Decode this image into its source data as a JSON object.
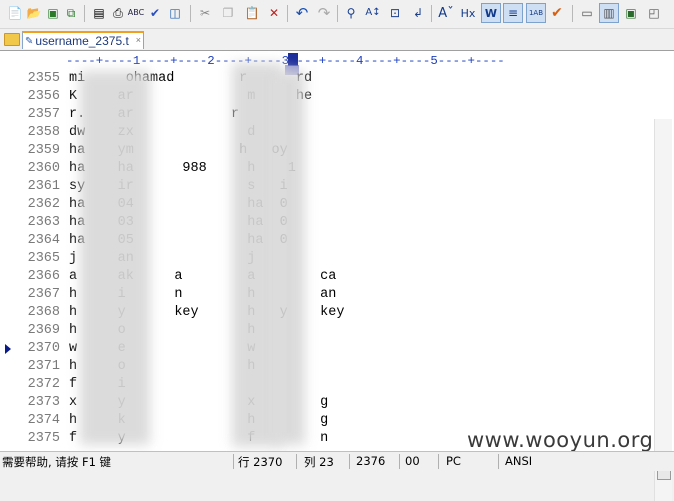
{
  "toolbar": {
    "icons": [
      "new-file-icon",
      "open-folder-icon",
      "save-icon",
      "save-all-icon",
      "print-preview-icon",
      "print-icon",
      "spellcheck-icon",
      "check-icon",
      "web-preview-icon",
      "cut-icon",
      "copy-icon",
      "paste-icon",
      "delete-icon",
      "undo-icon",
      "redo-icon",
      "find-icon",
      "replace-icon",
      "goto-icon",
      "insert-icon",
      "font-size-icon",
      "hex-icon",
      "word-wrap-icon",
      "ruler-icon",
      "line-numbers-icon",
      "spell-check-icon",
      "view-icon",
      "fullscreen-icon",
      "window-icon",
      "clip-icon"
    ]
  },
  "tab": {
    "label": "username_2375.t"
  },
  "ruler": {
    "text": "----+----1----+----2----+----3----+----4----+----5----+----"
  },
  "editor": {
    "current_line": "2370",
    "lines": [
      {
        "no": "2355",
        "text": "mi     ohamad        r      rd"
      },
      {
        "no": "2356",
        "text": "K     ar              m     he"
      },
      {
        "no": "2357",
        "text": "r.    ar            r          "
      },
      {
        "no": "2358",
        "text": "dw    zx              d      "
      },
      {
        "no": "2359",
        "text": "ha    ym             h   oy"
      },
      {
        "no": "2360",
        "text": "ha    ha      988     h    1"
      },
      {
        "no": "2361",
        "text": "sy    ir              s   i"
      },
      {
        "no": "2362",
        "text": "ha    04              ha  0"
      },
      {
        "no": "2363",
        "text": "ha    03              ha  0"
      },
      {
        "no": "2364",
        "text": "ha    05              ha  0"
      },
      {
        "no": "2365",
        "text": "j     an              j"
      },
      {
        "no": "2366",
        "text": "a     ak     a        a        ca"
      },
      {
        "no": "2367",
        "text": "h     i      n        h        an"
      },
      {
        "no": "2368",
        "text": "h     y      key      h   y    key"
      },
      {
        "no": "2369",
        "text": "h     o               h"
      },
      {
        "no": "2370",
        "text": "w     e               w"
      },
      {
        "no": "2371",
        "text": "h     o               h"
      },
      {
        "no": "2372",
        "text": "f     i                 "
      },
      {
        "no": "2373",
        "text": "x     y               x        g"
      },
      {
        "no": "2374",
        "text": "h     k               h        g"
      },
      {
        "no": "2375",
        "text": "f     y               f        n"
      }
    ]
  },
  "statusbar": {
    "help": "需要帮助, 请按 F1 键",
    "line": "行 2370",
    "col": "列 23",
    "chars": "2376",
    "code": "00",
    "platform": "PC",
    "encoding": "ANSI"
  },
  "watermark": "www.wooyun.org"
}
